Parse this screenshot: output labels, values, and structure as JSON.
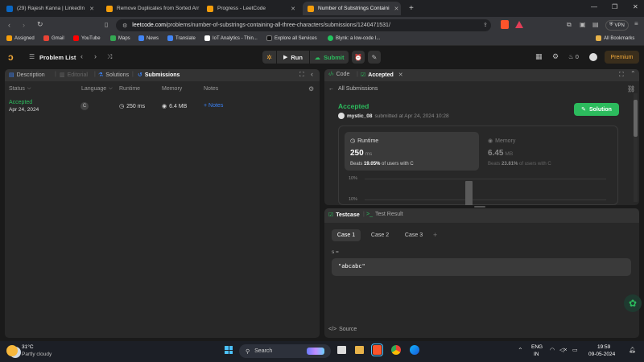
{
  "browser": {
    "tabs": [
      {
        "title": "(29) Rajesh Kanna | LinkedIn",
        "fav_color": "#0a66c2",
        "fav_text": "in"
      },
      {
        "title": "Remove Duplicates from Sorted Arr",
        "fav_color": "#f59e0b",
        "fav_text": "≥"
      },
      {
        "title": "Progress - LeetCode",
        "fav_color": "#f59e0b",
        "fav_text": "≥"
      },
      {
        "title": "Number of Substrings Containi",
        "fav_color": "#f59e0b",
        "fav_text": "≥"
      }
    ],
    "new_tab": "+",
    "url_host": "leetcode.com",
    "url_path": "/problems/number-of-substrings-containing-all-three-characters/submissions/1240471531/",
    "vpn": "VPN",
    "bookmarks": [
      {
        "label": "Assigned",
        "color": "#f59e0b"
      },
      {
        "label": "Gmail",
        "color": "#ea4335"
      },
      {
        "label": "YouTube",
        "color": "#ff0000"
      },
      {
        "label": "Maps",
        "color": "#34a853"
      },
      {
        "label": "News",
        "color": "#4285f4"
      },
      {
        "label": "Translate",
        "color": "#4285f4"
      },
      {
        "label": "IoT Analytics - Thin...",
        "color": "#ffffff"
      },
      {
        "label": "Explore all Services",
        "color": "#111111"
      },
      {
        "label": "Blynk: a low-code I...",
        "color": "#22c55e"
      }
    ],
    "all_bookmarks": "All Bookmarks"
  },
  "nav": {
    "problem_list": "Problem List",
    "run": "Run",
    "submit": "Submit",
    "streak": "0",
    "premium": "Premium"
  },
  "left_panel": {
    "tabs": [
      "Description",
      "Editorial",
      "Solutions",
      "Submissions"
    ],
    "columns": [
      "Status",
      "Language",
      "Runtime",
      "Memory",
      "Notes"
    ],
    "row": {
      "status": "Accepted",
      "date": "Apr 24, 2024",
      "language": "C",
      "runtime": "250 ms",
      "memory": "6.4 MB",
      "notes": "+ Notes"
    }
  },
  "right_panel": {
    "tabs": [
      "Code",
      "Accepted"
    ],
    "back_label": "All Submissions",
    "status": "Accepted",
    "user": "mystic_08",
    "submitted_at": "submitted at Apr 24, 2024 10:28",
    "solution_button": "Solution",
    "runtime_label": "Runtime",
    "runtime_value": "250",
    "runtime_unit": "ms",
    "runtime_beats_prefix": "Beats",
    "runtime_beats": "19.05%",
    "runtime_beats_suffix": "of users with C",
    "memory_label": "Memory",
    "memory_value": "6.45",
    "memory_unit": "MB",
    "memory_beats_prefix": "Beats",
    "memory_beats": "23.81%",
    "memory_beats_suffix": "of users with C",
    "chart_tick_top": "10%",
    "chart_tick_2": "10%"
  },
  "testcase_panel": {
    "tabs": [
      "Testcase",
      "Test Result"
    ],
    "cases": [
      "Case 1",
      "Case 2",
      "Case 3"
    ],
    "add": "+",
    "var_name": "s =",
    "value": "\"abcabc\"",
    "source": "Source"
  },
  "taskbar": {
    "temp": "31°C",
    "weather": "Partly cloudy",
    "search": "Search",
    "lang1": "ENG",
    "lang2": "IN",
    "time": "19:59",
    "date": "09-05-2024"
  }
}
